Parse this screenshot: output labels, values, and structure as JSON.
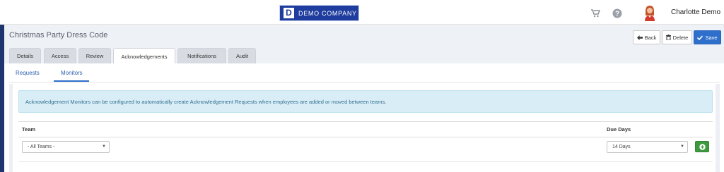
{
  "header": {
    "logo_letter": "D",
    "logo_text": "DEMO COMPANY",
    "user_name": "Charlotte Demo",
    "icons": [
      "cart-icon",
      "help-icon"
    ]
  },
  "page": {
    "title": "Christmas Party Dress Code"
  },
  "actions": {
    "back_label": "Back",
    "delete_label": "Delete",
    "save_label": "Save"
  },
  "tabs": [
    {
      "label": "Details"
    },
    {
      "label": "Access"
    },
    {
      "label": "Review"
    },
    {
      "label": "Acknowledgements",
      "active": true
    },
    {
      "label": "Notifications"
    },
    {
      "label": "Audit"
    }
  ],
  "subtabs": [
    {
      "label": "Requests"
    },
    {
      "label": "Monitors",
      "active": true
    }
  ],
  "info_message": "Acknowledgement Monitors can be configured to automatically create Acknowledgement Requests when employees are added or moved between teams.",
  "table": {
    "columns": {
      "team": "Team",
      "due_days": "Due Days"
    },
    "row": {
      "team_value": "- All Teams -",
      "due_value": "14 Days"
    }
  },
  "colors": {
    "brand": "#1e3d9e",
    "primary": "#2f6fcc",
    "success": "#3e9a3e",
    "info_bg": "#d9edf7"
  }
}
